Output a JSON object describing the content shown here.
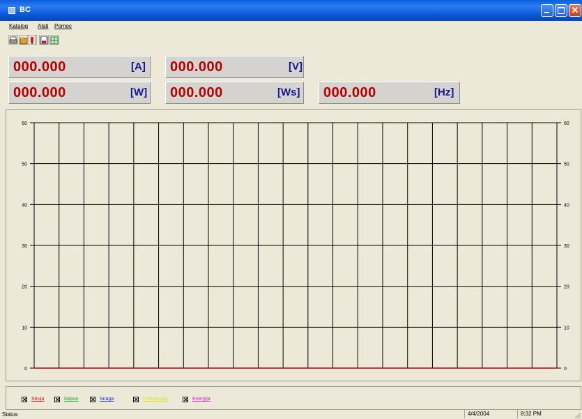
{
  "window": {
    "title": "BC"
  },
  "menu": [
    "Katalog",
    "Alati",
    "Pomoc"
  ],
  "toolbar": {
    "icons": [
      "print-icon",
      "open-folder-icon",
      "plug-icon",
      "save-icon",
      "table-icon"
    ]
  },
  "readouts": [
    {
      "name": "current",
      "value": "000.000",
      "unit": "[A]"
    },
    {
      "name": "voltage",
      "value": "000.000",
      "unit": "[V]"
    },
    {
      "name": "power",
      "value": "000.000",
      "unit": "[W]"
    },
    {
      "name": "energy",
      "value": "000.000",
      "unit": "[Ws]"
    },
    {
      "name": "frequency",
      "value": "000.000",
      "unit": "[Hz]"
    }
  ],
  "chart_data": {
    "type": "line",
    "ylim": [
      0,
      60
    ],
    "yticks": [
      "0",
      "10",
      "20",
      "30",
      "40",
      "50",
      "60"
    ],
    "y_axis_right": true,
    "grid": true,
    "vertical_grid_count": 21,
    "series": [
      {
        "name": "Struja",
        "values": [
          0,
          0
        ],
        "color": "#b40000"
      }
    ]
  },
  "legend": [
    {
      "label": "Struja",
      "checked": true,
      "color": "#e0120e"
    },
    {
      "label": "Napon",
      "checked": true,
      "color": "#23a629"
    },
    {
      "label": "Snaga",
      "checked": true,
      "color": "#2a2ad0"
    },
    {
      "label": "Frekvencija",
      "checked": true,
      "color": "#dede2a"
    },
    {
      "label": "Energija",
      "checked": true,
      "color": "#d027cf"
    }
  ],
  "statusbar": {
    "status": "Status",
    "date": "4/4/2004",
    "time": "8:32 PM"
  },
  "colors": {
    "titlebar": "#0a5fdc",
    "readout_value": "#b40000",
    "readout_unit": "#151594",
    "window": "#ece9d8"
  }
}
